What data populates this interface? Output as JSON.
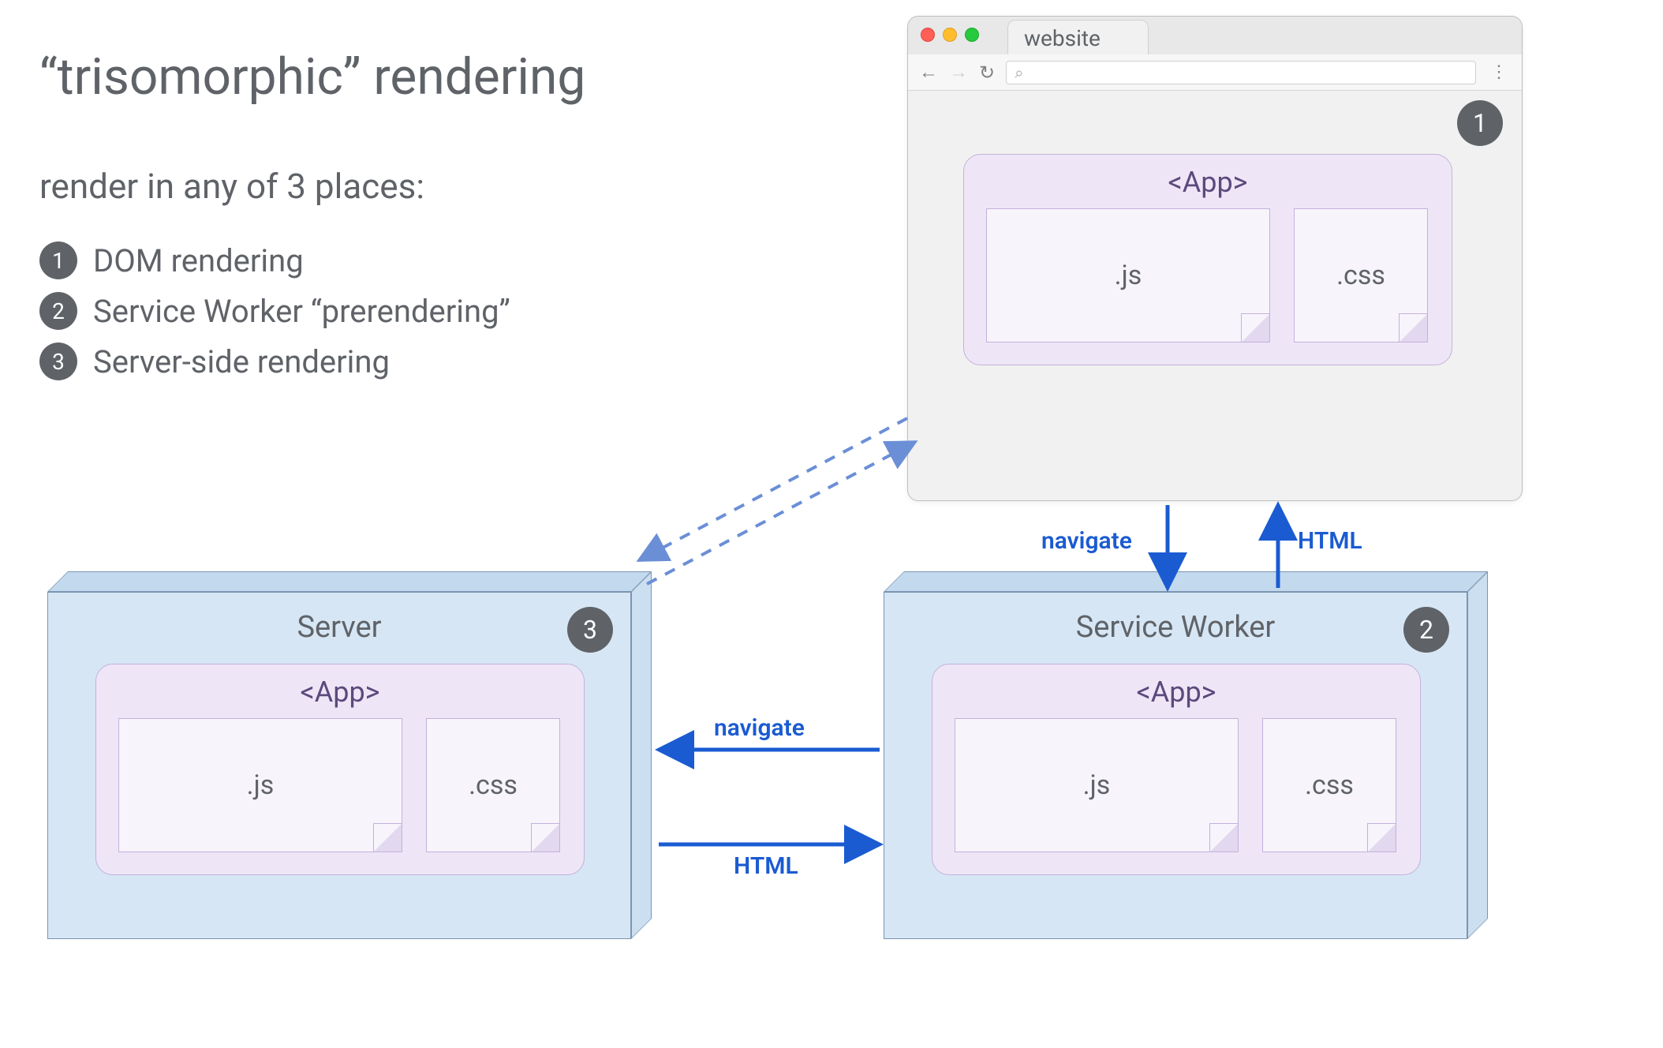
{
  "title": "“trisomorphic” rendering",
  "subtitle": "render in any of 3 places:",
  "list": [
    {
      "num": "1",
      "label": "DOM rendering"
    },
    {
      "num": "2",
      "label": "Service Worker “prerendering”"
    },
    {
      "num": "3",
      "label": "Server-side rendering"
    }
  ],
  "browser": {
    "tab": "website",
    "badge": "1",
    "nav": {
      "back": "←",
      "forward": "→",
      "reload": "↻",
      "search": "⌕",
      "menu": "⋮"
    }
  },
  "server_box": {
    "title": "Server",
    "badge": "3"
  },
  "sw_box": {
    "title": "Service Worker",
    "badge": "2"
  },
  "app": {
    "label": "<App>",
    "js": ".js",
    "css": ".css"
  },
  "arrows": {
    "navigate_down": "navigate",
    "html_up": "HTML",
    "navigate_left": "navigate",
    "html_right": "HTML"
  },
  "colors": {
    "text_gray": "#5f6368",
    "badge_gray": "#5f6368",
    "box_blue": "#d6e6f5",
    "box_border": "#7c95b0",
    "app_purple_bg": "#eee6f7",
    "app_purple_border": "#c3b2db",
    "app_purple_text": "#5a4a7c",
    "arrow_blue": "#1a5bd1",
    "arrow_dashed": "#6b8fd6"
  }
}
